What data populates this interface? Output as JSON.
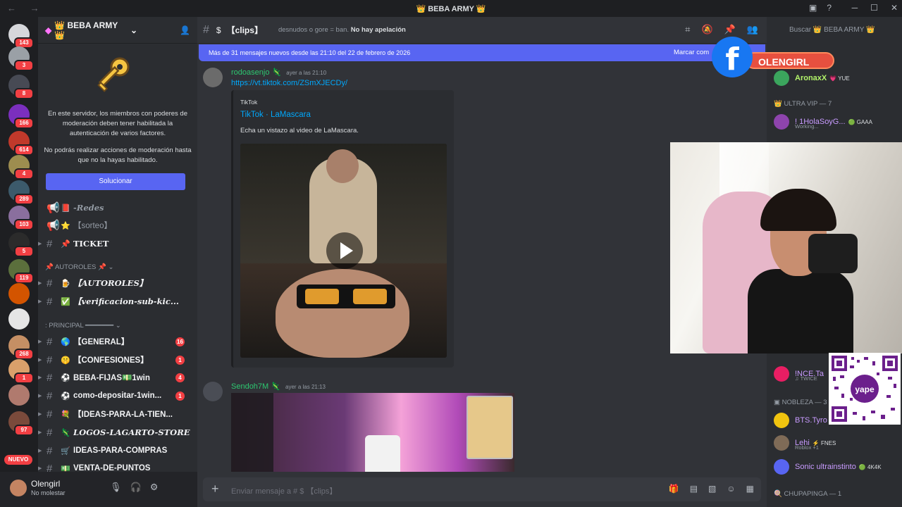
{
  "window": {
    "title": "👑 BEBA ARMY 👑"
  },
  "servers": {
    "items": [
      {
        "badge": "143",
        "color": "#d6d7db"
      },
      {
        "badge": "3",
        "color": "#9aa0a6"
      },
      {
        "badge": "8",
        "color": "#474a54"
      },
      {
        "badge": "166",
        "color": "#7b2fbe"
      },
      {
        "badge": "614",
        "color": "#c0392b"
      },
      {
        "badge": "4",
        "color": "#9d8d4f"
      },
      {
        "badge": "289",
        "color": "#3c5a6b"
      },
      {
        "badge": "103",
        "color": "#8a6f9e"
      },
      {
        "badge": "5",
        "color": "#2b2b2b"
      },
      {
        "badge": "119",
        "color": "#5b6f3c"
      },
      {
        "badge": "",
        "color": "#d35400"
      },
      {
        "badge": "",
        "color": "#e5e5e5"
      },
      {
        "badge": "268",
        "color": "#c58f64"
      },
      {
        "badge": "1",
        "color": "#d9a06b"
      },
      {
        "badge": "",
        "color": "#b07a6e"
      },
      {
        "badge": "97",
        "color": "#7a4a3b"
      }
    ],
    "new_label": "NUEVO"
  },
  "sidebar": {
    "guild_name": "👑 BEBA ARMY 👑",
    "mfa_text_1": "En este servidor, los miembros con poderes de moderación deben tener habilitada la autenticación de varios factores.",
    "mfa_text_2": "No podrás realizar acciones de moderación hasta que no la hayas habilitado.",
    "solve_button": "Solucionar",
    "channels_top": [
      {
        "icon": "📢",
        "emoji": "📕",
        "label": "-Redes"
      },
      {
        "icon": "📢",
        "emoji": "⭐",
        "label": "【sorteo】"
      },
      {
        "icon": "#",
        "emoji": "📌",
        "label": "TICKET"
      }
    ],
    "category_autoroles": "AUTOROLES 📌",
    "channels_auto": [
      {
        "emoji": "🍺",
        "label": "【AUTOROLES】"
      },
      {
        "emoji": "✅",
        "label": "【verificacion-sub-kic..."
      }
    ],
    "category_principal": ": PRINCIPAL ━━━━━━━",
    "channels_main": [
      {
        "emoji": "🌎",
        "label": "【GENERAL】",
        "count": "16"
      },
      {
        "emoji": "🤫",
        "label": "【CONFESIONES】",
        "count": "1"
      },
      {
        "emoji": "⚽",
        "label": "BEBA-FIJAS💵1win",
        "count": "4"
      },
      {
        "emoji": "⚽",
        "label": "como-depositar-1win...",
        "count": "1"
      },
      {
        "emoji": "💐",
        "label": "【IDEAS-PARA-LA-TIEN...",
        "count": ""
      },
      {
        "emoji": "🦎",
        "label": "LOGOS-LAGARTO-STORE",
        "count": ""
      },
      {
        "emoji": "🛒",
        "label": "IDEAS-PARA-COMPRAS",
        "count": ""
      },
      {
        "emoji": "💵",
        "label": "VENTA-DE-PUNTOS",
        "count": ""
      }
    ]
  },
  "user": {
    "name": "Olengirl",
    "status": "No molestar"
  },
  "chat": {
    "channel_name": "【clips】",
    "topic_prefix": "desnudos o gore = ban.",
    "topic_bold": "No hay apelación",
    "new_messages": "Más de 31 mensajes nuevos desde las 21:10 del 22 de febrero de 2026",
    "mark_read": "Marcar com",
    "messages": [
      {
        "author": "rodoasenjo",
        "time": "ayer a las 21:10",
        "link": "https://vt.tiktok.com/ZSmXJECDy/"
      },
      {
        "author": "Sendoh7M",
        "time": "ayer a las 21:13"
      }
    ],
    "embed": {
      "provider": "TikTok",
      "title": "TikTok · LaMascara",
      "description": "Echa un vistazo al video de LaMascara."
    },
    "composer_placeholder": "Enviar mensaje a # $ 【clips】"
  },
  "members": {
    "search_placeholder": "Buscar 👑 BEBA ARMY 👑",
    "list": [
      {
        "name": "AronaxX",
        "tag": "💗 YUE",
        "sub": "",
        "color": "#3ba55d"
      },
      {
        "name": "! 1HolaSoyG...",
        "tag": "🟢 GAAA",
        "sub": "Working...",
        "color": "#8e44ad"
      },
      {
        "name": "!NCE.Ta",
        "tag": "",
        "sub": "♫ TWICE",
        "color": "#e91e63"
      },
      {
        "name": "BTS.Tyro",
        "tag": "",
        "sub": "",
        "color": "#f1c40f"
      },
      {
        "name": "Lehi",
        "tag": "⚡ FNES",
        "sub": "Roblox +1",
        "color": "#7f6b57"
      },
      {
        "name": "Sonic ultrainstinto",
        "tag": "🟢 4K4K",
        "sub": "",
        "color": "#5865f2"
      }
    ],
    "groups": {
      "vip": "ULTRA VIP — 7",
      "nobleza": "NOBLEZA — 3",
      "chupa": "CHUPAPINGA — 1"
    }
  },
  "overlay": {
    "facebook_name": "OLENGIRL"
  }
}
